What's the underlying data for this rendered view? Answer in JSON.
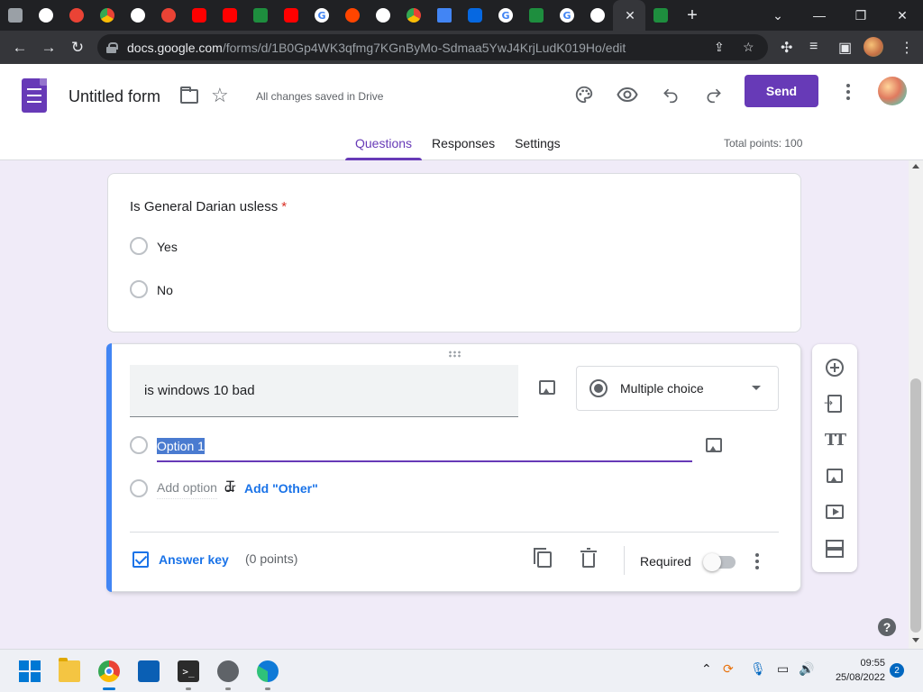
{
  "browser": {
    "url_domain": "docs.google.com",
    "url_path": "/forms/d/1B0Gp4WK3qfmg7KGnByMo-Sdmaa5YwJ4KrjLudK019Ho/edit",
    "tab_close": "✕",
    "new_tab": "+"
  },
  "form_header": {
    "title": "Untitled form",
    "save_status": "All changes saved in Drive",
    "send_label": "Send",
    "tabs": [
      "Questions",
      "Responses",
      "Settings"
    ],
    "active_tab": "Questions",
    "total_points": "Total points: 100"
  },
  "question1": {
    "title": "Is General Darian usless",
    "required_marker": "*",
    "options": [
      "Yes",
      "No"
    ]
  },
  "question2": {
    "title": "is windows 10 bad",
    "type": "Multiple choice",
    "option1": "Option 1",
    "add_option": "Add option",
    "or": "or",
    "add_other": "Add \"Other\"",
    "answer_key": "Answer key",
    "points": "(0 points)",
    "required_label": "Required",
    "required_on": false
  },
  "side_toolbar": {
    "icons": [
      "add-question-icon",
      "import-questions-icon",
      "add-title-icon",
      "add-image-icon",
      "add-video-icon",
      "add-section-icon"
    ]
  },
  "help": "?",
  "taskbar": {
    "time": "09:55",
    "date": "25/08/2022",
    "notifications": "2"
  },
  "colors": {
    "accent": "#673ab7",
    "active_border": "#4285f4",
    "link": "#1a73e8",
    "background": "#f0ebf8"
  }
}
